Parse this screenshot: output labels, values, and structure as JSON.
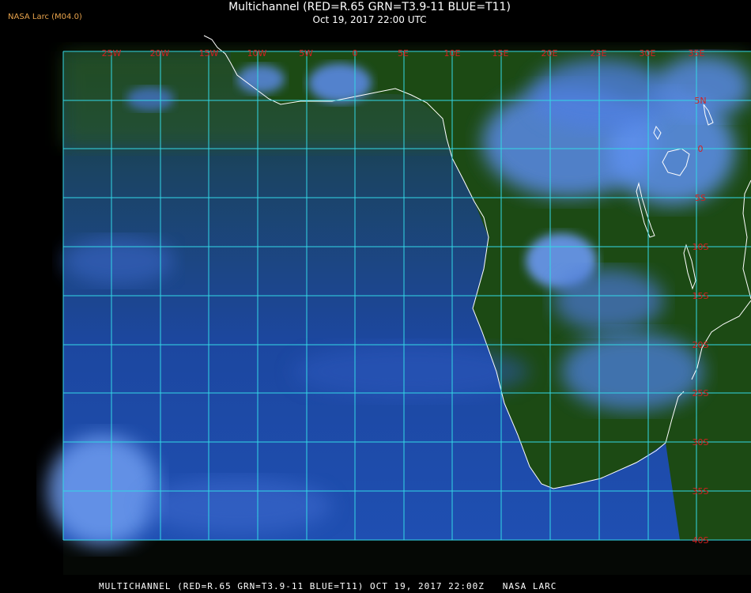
{
  "corner_label": "NASA Larc (M04.0)",
  "title": "Multichannel (RED=R.65 GRN=T3.9-11 BLUE=T11)",
  "subtitle": "Oct 19, 2017 22:00 UTC",
  "footer": "MULTICHANNEL (RED=R.65 GRN=T3.9-11 BLUE=T11) OCT 19, 2017 22:00Z   NASA LARC",
  "map": {
    "longitude_labels": [
      "25W",
      "20W",
      "15W",
      "10W",
      "5W",
      "0",
      "5E",
      "10E",
      "15E",
      "20E",
      "25E",
      "30E",
      "35E"
    ],
    "latitude_labels": [
      "5N",
      "0",
      "5S",
      "10S",
      "15S",
      "20S",
      "25S",
      "30S",
      "35S",
      "40S"
    ],
    "grid_color": "#33d8e6",
    "label_color": "#d42020",
    "coastline_color": "#ffffff"
  },
  "colors": {
    "land_green": "#1e4a12",
    "ocean_blue": "#1a3f8e",
    "cloud_blue": "#5c8cf0"
  }
}
